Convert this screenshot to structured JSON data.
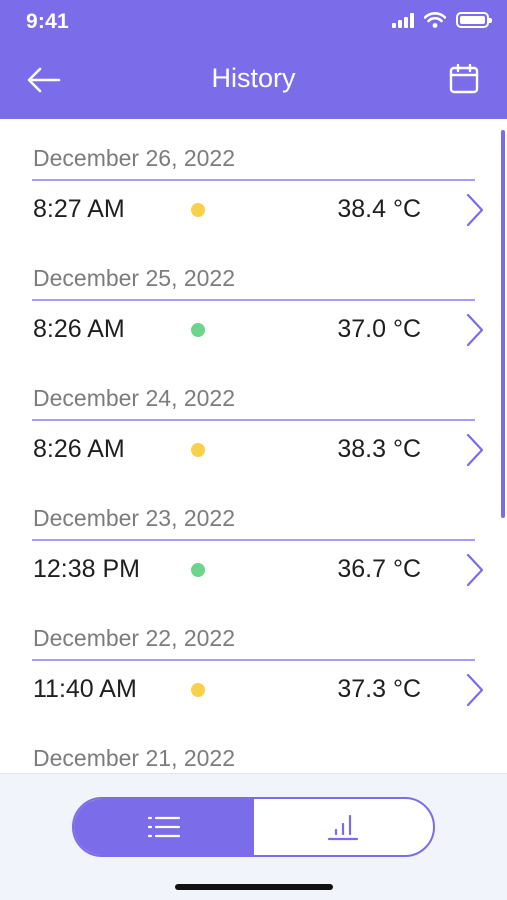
{
  "status_bar": {
    "time": "9:41"
  },
  "header": {
    "title": "History"
  },
  "entries": [
    {
      "date": "December 26, 2022",
      "time": "8:27 AM",
      "temp": "38.4 °C",
      "status_color": "#F9D04A"
    },
    {
      "date": "December 25, 2022",
      "time": "8:26 AM",
      "temp": "37.0 °C",
      "status_color": "#6BD68A"
    },
    {
      "date": "December 24, 2022",
      "time": "8:26 AM",
      "temp": "38.3 °C",
      "status_color": "#F9D04A"
    },
    {
      "date": "December 23, 2022",
      "time": "12:38 PM",
      "temp": "36.7 °C",
      "status_color": "#6BD68A"
    },
    {
      "date": "December 22, 2022",
      "time": "11:40 AM",
      "temp": "37.3 °C",
      "status_color": "#F9D04A"
    },
    {
      "date": "December 21, 2022"
    }
  ],
  "view_toggle": {
    "selected": "list",
    "options": [
      "list-icon",
      "bar-chart-icon"
    ]
  },
  "colors": {
    "accent": "#7B6CEA",
    "warning": "#F9D04A",
    "normal": "#6BD68A"
  }
}
